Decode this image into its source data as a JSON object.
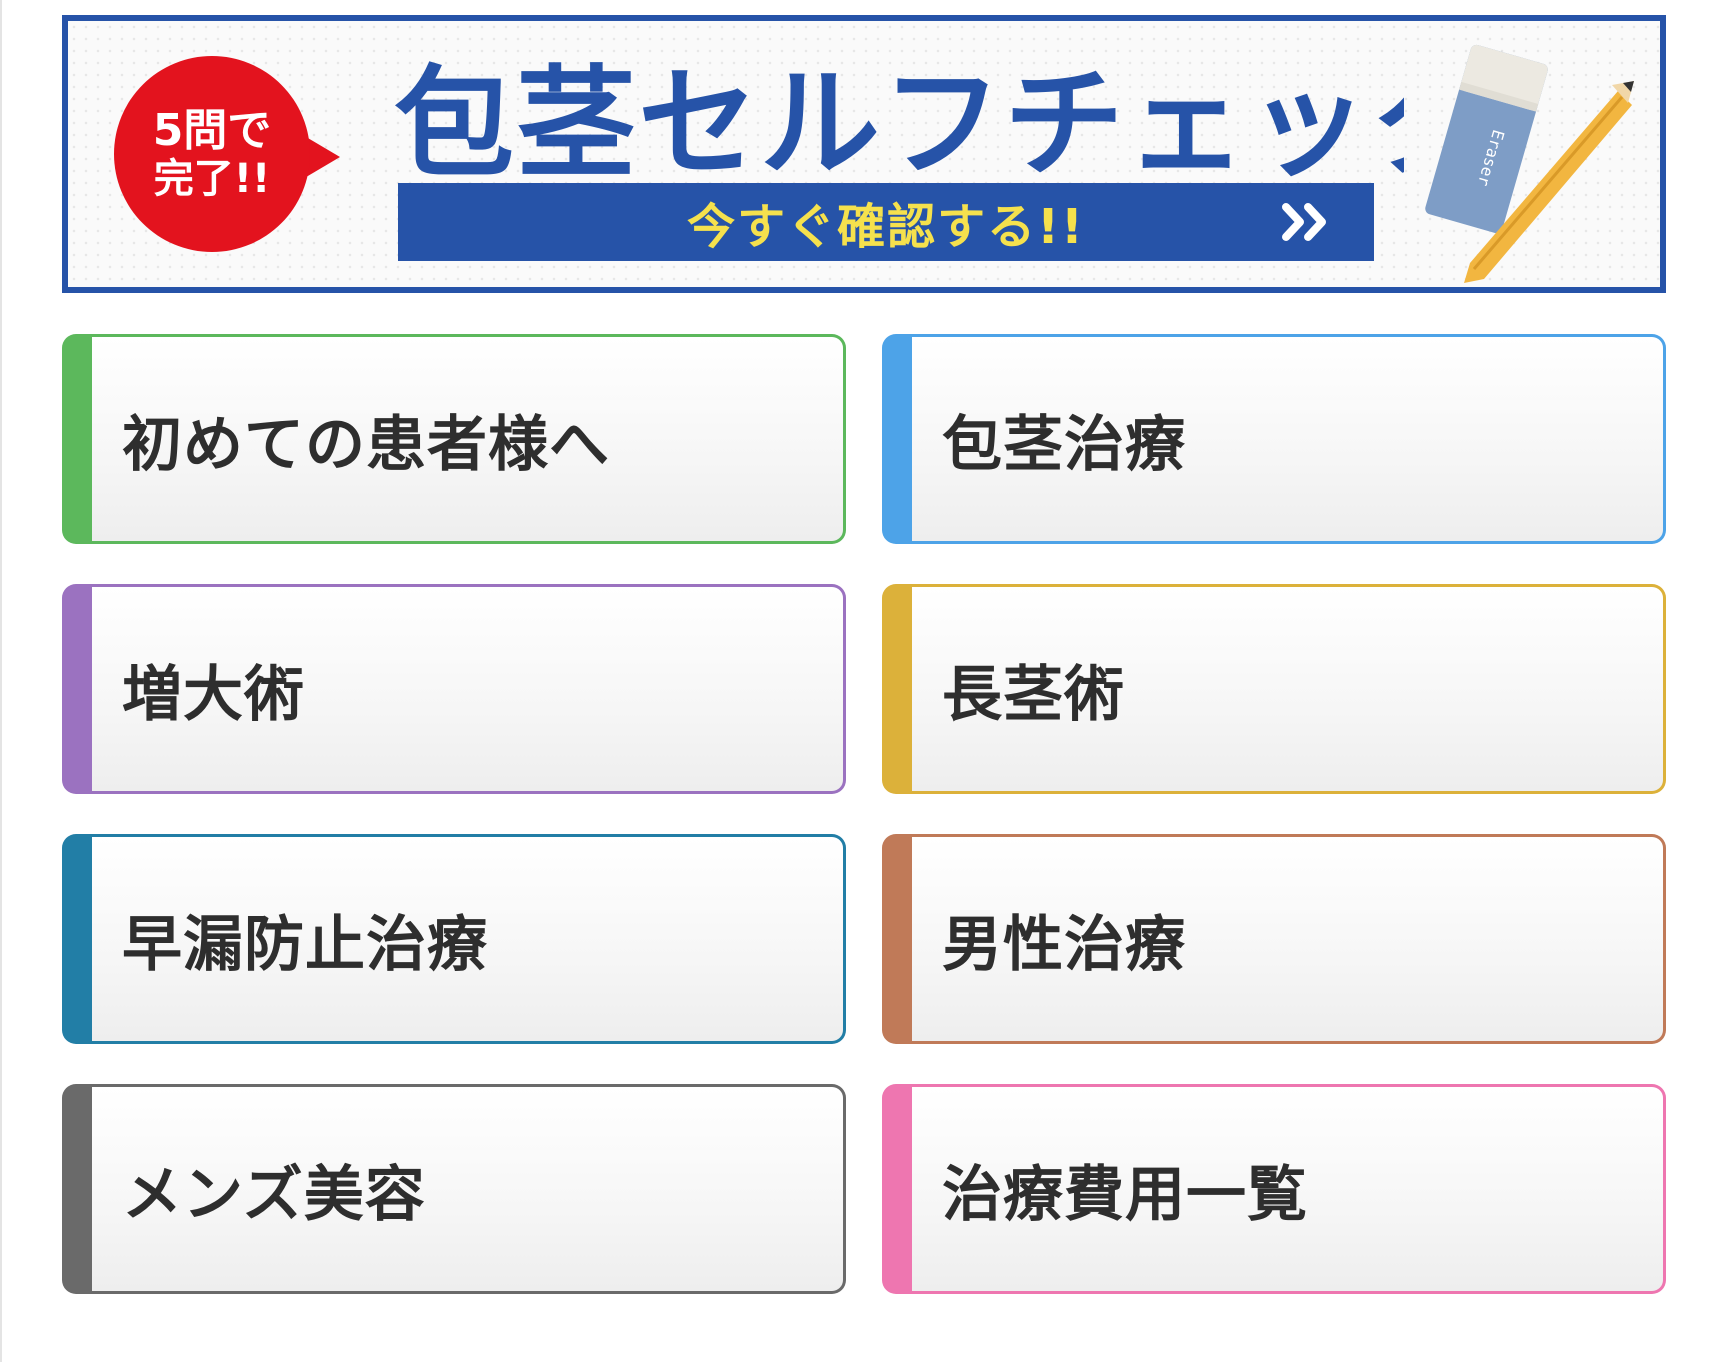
{
  "banner": {
    "badge_line1": "5問で",
    "badge_line2": "完了!!",
    "title": "包茎セルフチェック",
    "cta_label": "今すぐ確認する!!",
    "eraser_text": "Eraser",
    "icons": [
      "chevrons-right-icon",
      "eraser-icon",
      "pencil-icon"
    ],
    "colors": {
      "frame": "#2653a8",
      "badge": "#e3131e",
      "cta_text": "#f5e14d"
    }
  },
  "nav": {
    "items": [
      {
        "label": "初めての患者様へ",
        "color": "#5cb85c"
      },
      {
        "label": "包茎治療",
        "color": "#4da3e8"
      },
      {
        "label": "増大術",
        "color": "#9b72c0"
      },
      {
        "label": "長茎術",
        "color": "#dcb13a"
      },
      {
        "label": "早漏防止治療",
        "color": "#227ea6"
      },
      {
        "label": "男性治療",
        "color": "#c07a58"
      },
      {
        "label": "メンズ美容",
        "color": "#6a6a6a"
      },
      {
        "label": "治療費用一覧",
        "color": "#ee76b0"
      }
    ]
  }
}
